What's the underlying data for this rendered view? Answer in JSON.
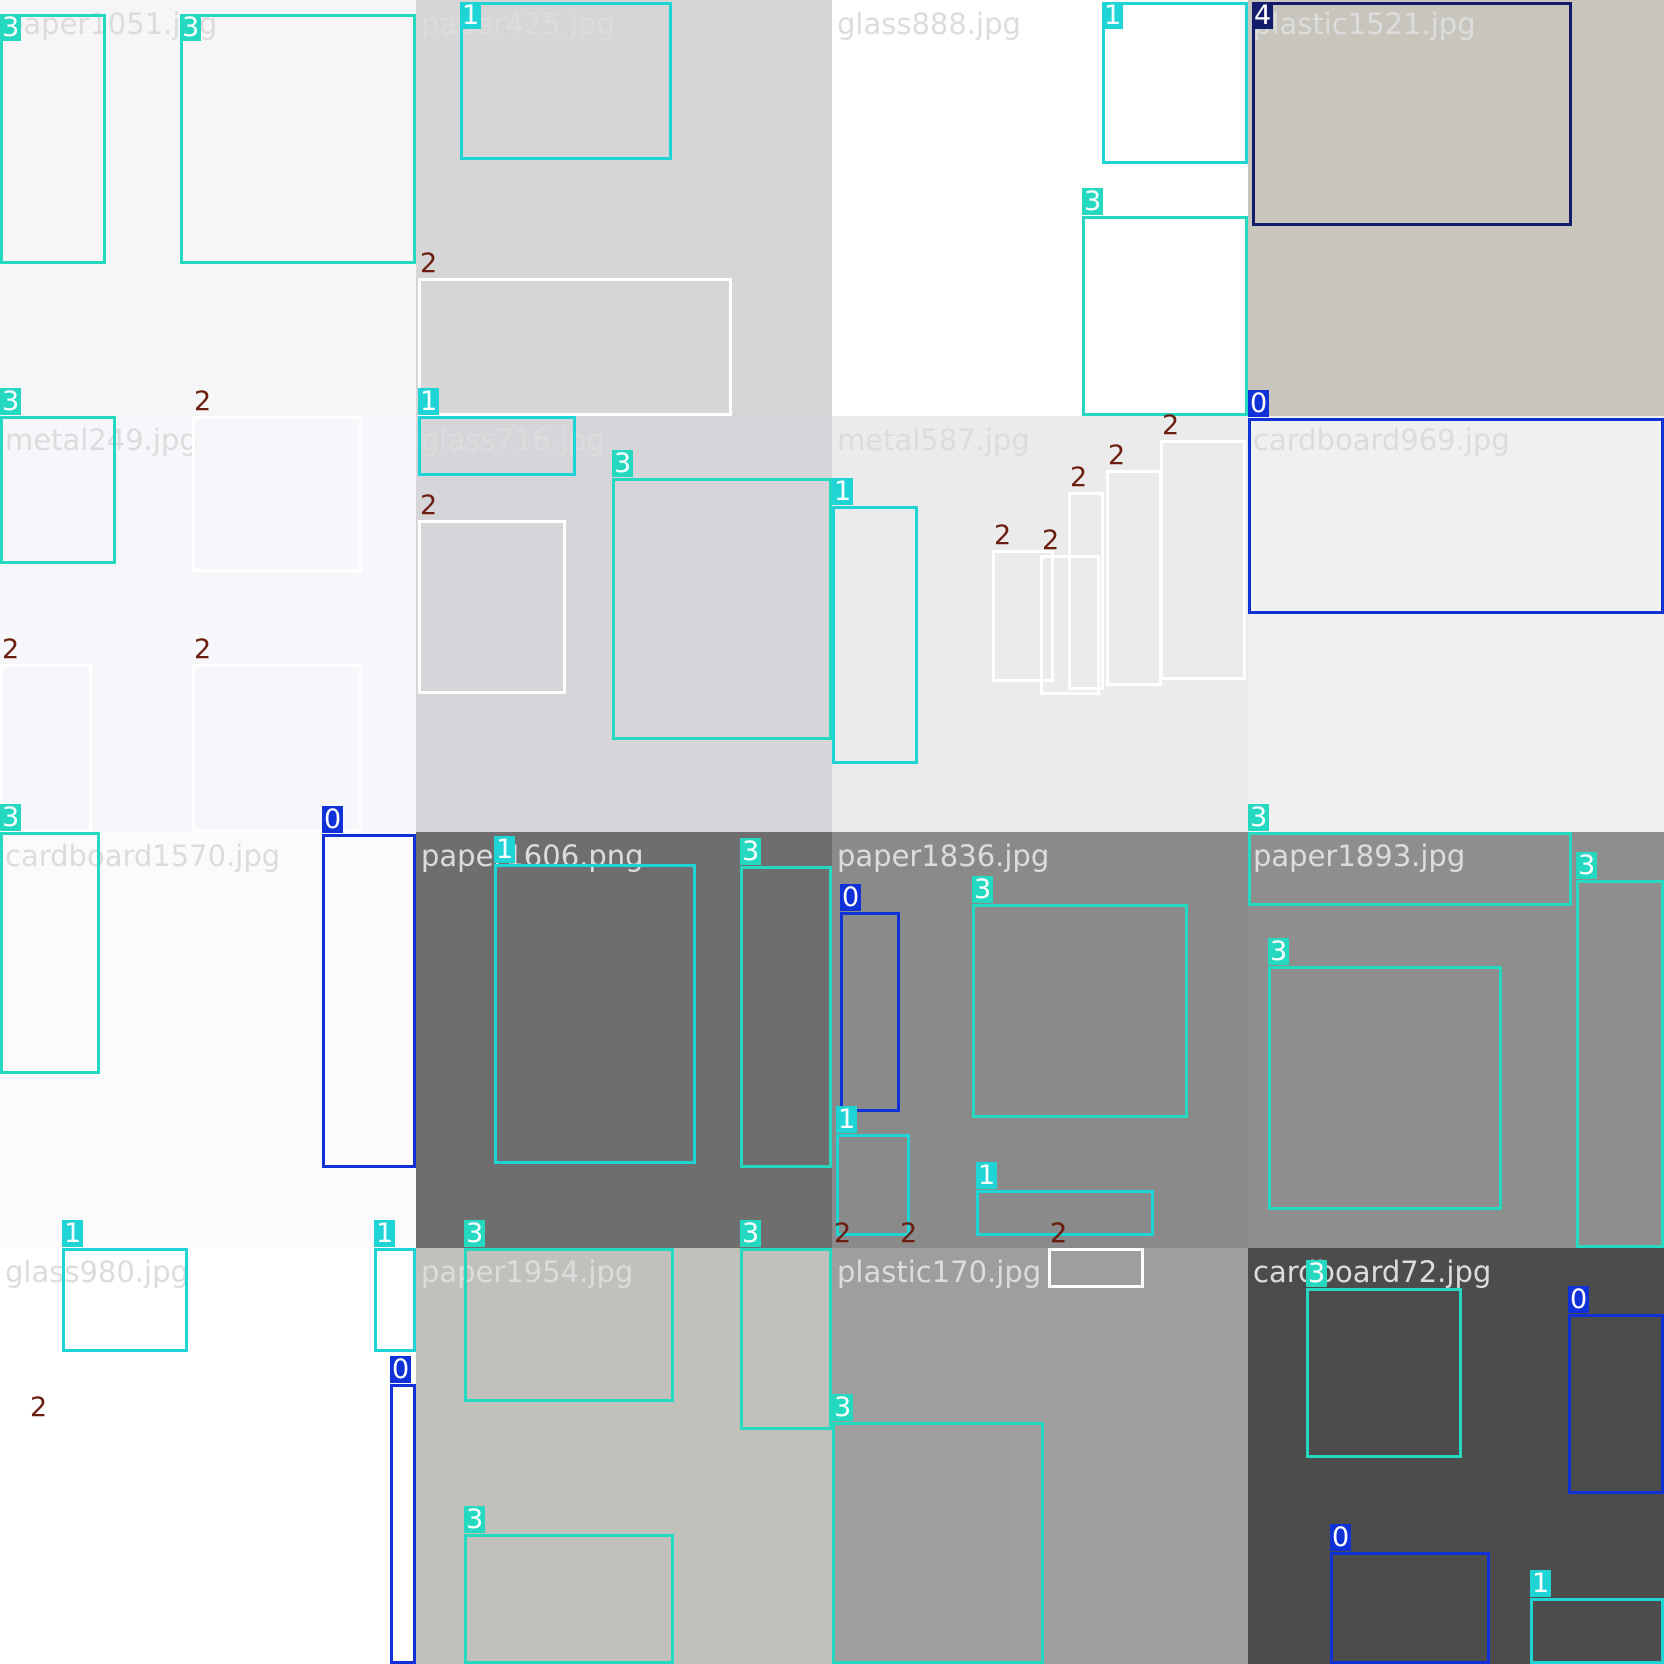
{
  "colors": {
    "class_0": "#1030d8",
    "class_1": "#1fd4d4",
    "class_2": "#ffffff",
    "class_3": "#25d8c0",
    "class_4": "#131c6c",
    "label_2_text": "#6b1d0f"
  },
  "tiles": [
    {
      "filename": "paper1051.jpg",
      "bg": "#f6f5f8"
    },
    {
      "filename": "paper425.jpg",
      "bg": "#d6d6d6"
    },
    {
      "filename": "glass888.jpg",
      "bg": "#ffffff"
    },
    {
      "filename": "plastic1521.jpg",
      "bg": "#c8c6bc"
    },
    {
      "filename": "metal249.jpg",
      "bg": "#f7f6fa"
    },
    {
      "filename": "glass716.jpg",
      "bg": "#d6d6da"
    },
    {
      "filename": "metal587.jpg",
      "bg": "#ebebeb"
    },
    {
      "filename": "cardboard969.jpg",
      "bg": "#f0f0f0"
    },
    {
      "filename": "cardboard1570.jpg",
      "bg": "#fbfbfd"
    },
    {
      "filename": "paper1606.png",
      "bg": "#6e6e6e"
    },
    {
      "filename": "paper1836.jpg",
      "bg": "#8a8a8a"
    },
    {
      "filename": "paper1893.jpg",
      "bg": "#8e8e8e"
    },
    {
      "filename": "glass980.jpg",
      "bg": "#ffffff"
    },
    {
      "filename": "paper1954.jpg",
      "bg": "#c2c0bb"
    },
    {
      "filename": "plastic170.jpg",
      "bg": "#9e9e9e"
    },
    {
      "filename": "cardboard72.jpg",
      "bg": "#4c4c4c"
    }
  ],
  "boxes": [
    {
      "label": "3",
      "cls": 3
    },
    {
      "label": "3",
      "cls": 3
    },
    {
      "label": "1",
      "cls": 1
    },
    {
      "label": "2",
      "cls": 2
    },
    {
      "label": "1",
      "cls": 1
    },
    {
      "label": "3",
      "cls": 3
    },
    {
      "label": "4",
      "cls": 4
    },
    {
      "label": "3",
      "cls": 3
    },
    {
      "label": "2",
      "cls": 2
    },
    {
      "label": "2",
      "cls": 2
    },
    {
      "label": "2",
      "cls": 2
    },
    {
      "label": "3",
      "cls": 3
    },
    {
      "label": "1",
      "cls": 1
    },
    {
      "label": "2",
      "cls": 2
    },
    {
      "label": "3",
      "cls": 3
    },
    {
      "label": "1",
      "cls": 1
    },
    {
      "label": "2",
      "cls": 2
    },
    {
      "label": "2",
      "cls": 2
    },
    {
      "label": "2",
      "cls": 2
    },
    {
      "label": "2",
      "cls": 2
    },
    {
      "label": "2",
      "cls": 2
    },
    {
      "label": "0",
      "cls": 0
    },
    {
      "label": "3",
      "cls": 3
    },
    {
      "label": "0",
      "cls": 0
    },
    {
      "label": "1",
      "cls": 1
    },
    {
      "label": "3",
      "cls": 3
    },
    {
      "label": "0",
      "cls": 0
    },
    {
      "label": "3",
      "cls": 3
    },
    {
      "label": "1",
      "cls": 1
    },
    {
      "label": "1",
      "cls": 1
    },
    {
      "label": "3",
      "cls": 3
    },
    {
      "label": "3",
      "cls": 3
    },
    {
      "label": "2",
      "cls": 2
    },
    {
      "label": "1",
      "cls": 1
    },
    {
      "label": "1",
      "cls": 1
    },
    {
      "label": "2",
      "cls": 2
    },
    {
      "label": "0",
      "cls": 0
    },
    {
      "label": "3",
      "cls": 3
    },
    {
      "label": "3",
      "cls": 3
    },
    {
      "label": "3",
      "cls": 3
    },
    {
      "label": "2",
      "cls": 2
    },
    {
      "label": "2",
      "cls": 2
    },
    {
      "label": "2",
      "cls": 2
    },
    {
      "label": "3",
      "cls": 3
    },
    {
      "label": "3",
      "cls": 3
    },
    {
      "label": "0",
      "cls": 0
    },
    {
      "label": "0",
      "cls": 0
    },
    {
      "label": "1",
      "cls": 1
    }
  ]
}
